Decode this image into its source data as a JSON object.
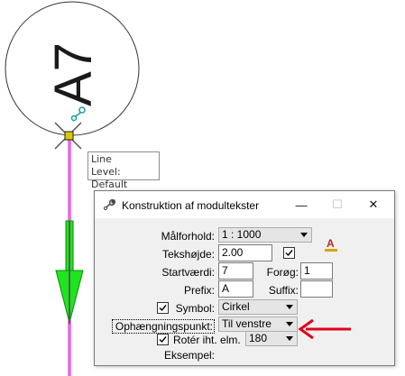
{
  "drawing": {
    "cell_label": "A7",
    "element_line_color": "#d400d4",
    "arrow_green": "#1ee61e",
    "arrow_red": "#e0001b"
  },
  "tooltip": {
    "line1": "Line",
    "line2": "Level: Default"
  },
  "dialog": {
    "title": "Konstruktion af modultekster",
    "minimize_glyph": "—",
    "maximize_glyph": "☐",
    "close_glyph": "✕",
    "fields": {
      "malforhold_label": "Målforhold:",
      "malforhold_value": "1 : 1000",
      "tekstoejde_label": "Tekshøjde:",
      "tekstoejde_value": "2.00",
      "tekstoejde_checked": true,
      "startvaerdi_label": "Startværdi:",
      "startvaerdi_value": "7",
      "forog_label": "Forøg:",
      "forog_value": "1",
      "prefix_label": "Prefix:",
      "prefix_value": "A",
      "suffix_label": "Suffix:",
      "suffix_value": "",
      "symbol_label": "Symbol:",
      "symbol_checked": true,
      "symbol_value": "Cirkel",
      "ophaeng_label": "Ophængningspunkt:",
      "ophaeng_value": "Til venstre",
      "roter_label": "Rotér iht. elm.",
      "roter_checked": true,
      "roter_value": "180",
      "eksempel_label": "Eksempel:"
    },
    "text_style_icon_letter": "A"
  }
}
